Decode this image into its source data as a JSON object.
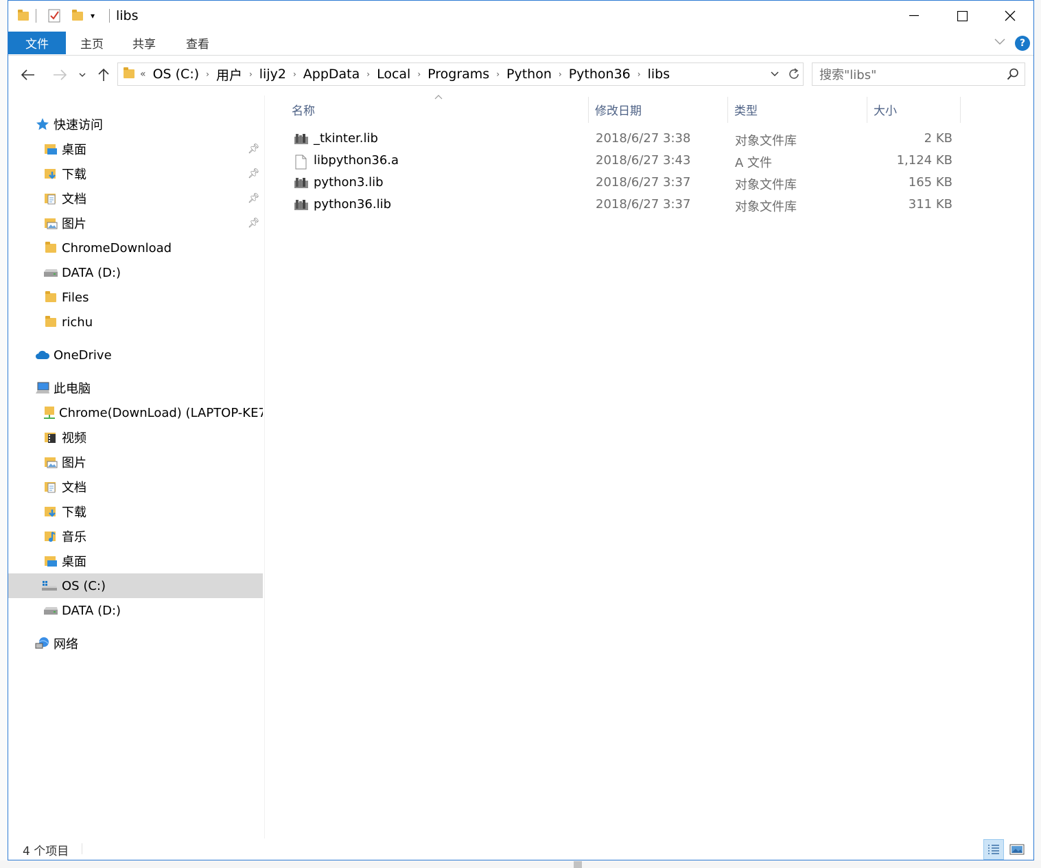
{
  "window": {
    "title": "libs",
    "controls": {
      "minimize": "—",
      "maximize": "☐",
      "close": "✕"
    }
  },
  "ribbon": {
    "tabs": [
      {
        "label": "文件",
        "active": true
      },
      {
        "label": "主页",
        "active": false
      },
      {
        "label": "共享",
        "active": false
      },
      {
        "label": "查看",
        "active": false
      }
    ],
    "help": "?"
  },
  "address_bar": {
    "overflow": "«",
    "crumbs": [
      "OS (C:)",
      "用户",
      "lijy2",
      "AppData",
      "Local",
      "Programs",
      "Python",
      "Python36",
      "libs"
    ],
    "search_placeholder": "搜索\"libs\""
  },
  "sidebar": {
    "quick_access": {
      "label": "快速访问",
      "items": [
        {
          "label": "桌面",
          "icon": "desktop-folder-icon",
          "pinned": true
        },
        {
          "label": "下载",
          "icon": "downloads-folder-icon",
          "pinned": true
        },
        {
          "label": "文档",
          "icon": "documents-folder-icon",
          "pinned": true
        },
        {
          "label": "图片",
          "icon": "pictures-folder-icon",
          "pinned": true
        },
        {
          "label": "ChromeDownload",
          "icon": "folder-icon",
          "pinned": false
        },
        {
          "label": "DATA (D:)",
          "icon": "drive-icon",
          "pinned": false
        },
        {
          "label": "Files",
          "icon": "folder-icon",
          "pinned": false
        },
        {
          "label": "richu",
          "icon": "folder-icon",
          "pinned": false
        }
      ]
    },
    "onedrive": {
      "label": "OneDrive"
    },
    "this_pc": {
      "label": "此电脑",
      "items": [
        {
          "label": "Chrome(DownLoad) (LAPTOP-KE7…",
          "icon": "network-folder-icon"
        },
        {
          "label": "视频",
          "icon": "videos-folder-icon"
        },
        {
          "label": "图片",
          "icon": "pictures-folder-icon"
        },
        {
          "label": "文档",
          "icon": "documents-folder-icon"
        },
        {
          "label": "下载",
          "icon": "downloads-folder-icon"
        },
        {
          "label": "音乐",
          "icon": "music-folder-icon"
        },
        {
          "label": "桌面",
          "icon": "desktop-folder-icon"
        },
        {
          "label": "OS (C:)",
          "icon": "windows-drive-icon",
          "selected": true
        },
        {
          "label": "DATA (D:)",
          "icon": "drive-icon"
        }
      ]
    },
    "network": {
      "label": "网络"
    }
  },
  "file_list": {
    "columns": {
      "name": "名称",
      "date": "修改日期",
      "type": "类型",
      "size": "大小"
    },
    "rows": [
      {
        "name": "_tkinter.lib",
        "date": "2018/6/27 3:38",
        "type": "对象文件库",
        "size": "2 KB",
        "icon": "library-file-icon"
      },
      {
        "name": "libpython36.a",
        "date": "2018/6/27 3:43",
        "type": "A 文件",
        "size": "1,124 KB",
        "icon": "blank-file-icon"
      },
      {
        "name": "python3.lib",
        "date": "2018/6/27 3:37",
        "type": "对象文件库",
        "size": "165 KB",
        "icon": "library-file-icon"
      },
      {
        "name": "python36.lib",
        "date": "2018/6/27 3:37",
        "type": "对象文件库",
        "size": "311 KB",
        "icon": "library-file-icon"
      }
    ]
  },
  "status": {
    "item_count": "4 个项目"
  },
  "colors": {
    "accent": "#1979ca",
    "selected_bg": "#d9d9d9",
    "header_text": "#4d6185"
  }
}
